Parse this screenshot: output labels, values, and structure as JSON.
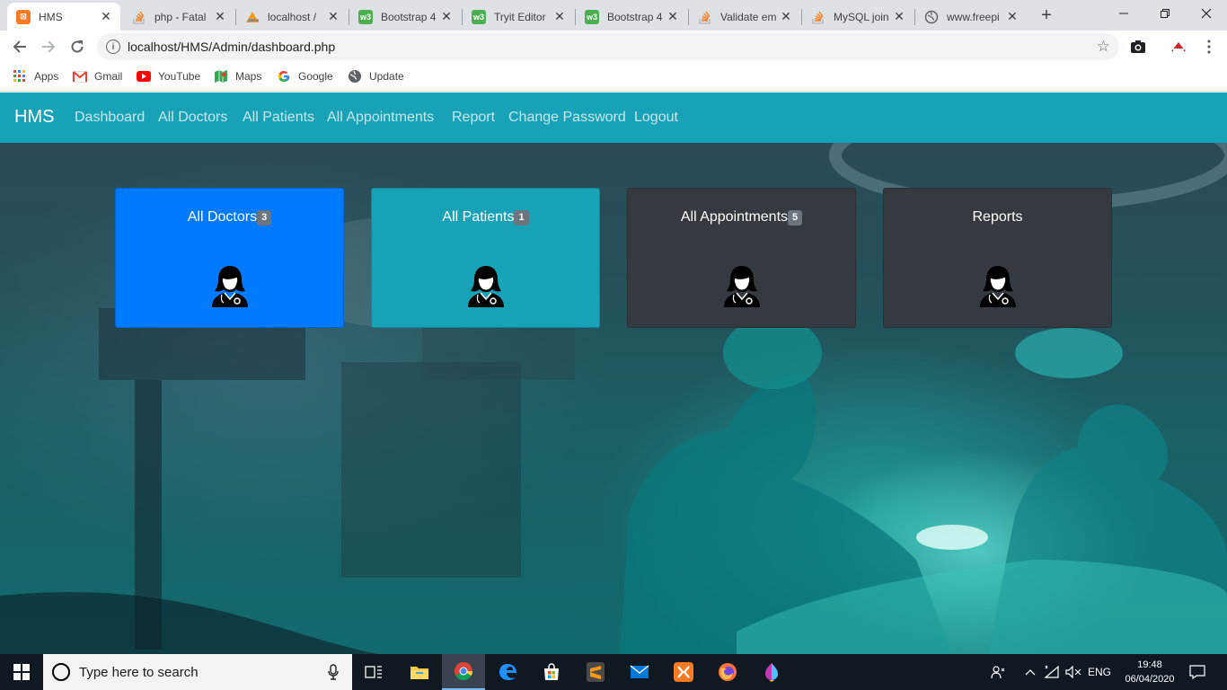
{
  "browser": {
    "tabs": [
      {
        "title": "HMS",
        "favicon": "xampp-icon",
        "active": true
      },
      {
        "title": "php - Fatal",
        "favicon": "stackoverflow-icon"
      },
      {
        "title": "localhost /",
        "favicon": "phpmyadmin-icon"
      },
      {
        "title": "Bootstrap 4",
        "favicon": "w3schools-icon"
      },
      {
        "title": "Tryit Editor",
        "favicon": "w3schools-icon"
      },
      {
        "title": "Bootstrap 4",
        "favicon": "w3schools-icon"
      },
      {
        "title": "Validate em",
        "favicon": "stackoverflow-icon"
      },
      {
        "title": "MySQL join",
        "favicon": "stackoverflow-icon"
      },
      {
        "title": "www.freepi",
        "favicon": "globe-icon"
      }
    ],
    "url": "localhost/HMS/Admin/dashboard.php",
    "bookmarks": [
      {
        "label": "Apps",
        "icon": "apps-grid-icon"
      },
      {
        "label": "Gmail",
        "icon": "gmail-icon"
      },
      {
        "label": "YouTube",
        "icon": "youtube-icon"
      },
      {
        "label": "Maps",
        "icon": "maps-icon"
      },
      {
        "label": "Google",
        "icon": "google-icon"
      },
      {
        "label": "Update",
        "icon": "globe-icon"
      }
    ]
  },
  "app": {
    "brand": "HMS",
    "nav": [
      "Dashboard",
      "All Doctors",
      "All Patients",
      "All Appointments",
      "Report",
      "Change Password",
      "Logout"
    ],
    "cards": [
      {
        "title": "All Doctors",
        "count": "3",
        "bg": "#007bff",
        "icon": "doctor-icon"
      },
      {
        "title": "All Patients",
        "count": "1",
        "bg": "#17a2b8",
        "icon": "doctor-icon"
      },
      {
        "title": "All Appointments",
        "count": "5",
        "bg": "#343a40",
        "icon": "doctor-icon"
      },
      {
        "title": "Reports",
        "count": "",
        "bg": "#343a40",
        "icon": "doctor-icon"
      }
    ]
  },
  "taskbar": {
    "search_placeholder": "Type here to search",
    "language": "ENG",
    "time": "19:48",
    "date": "06/04/2020"
  },
  "colors": {
    "navbar": "#17a2b8",
    "primary": "#007bff",
    "info": "#17a2b8",
    "dark": "#343a40",
    "badge": "#6c757d"
  }
}
